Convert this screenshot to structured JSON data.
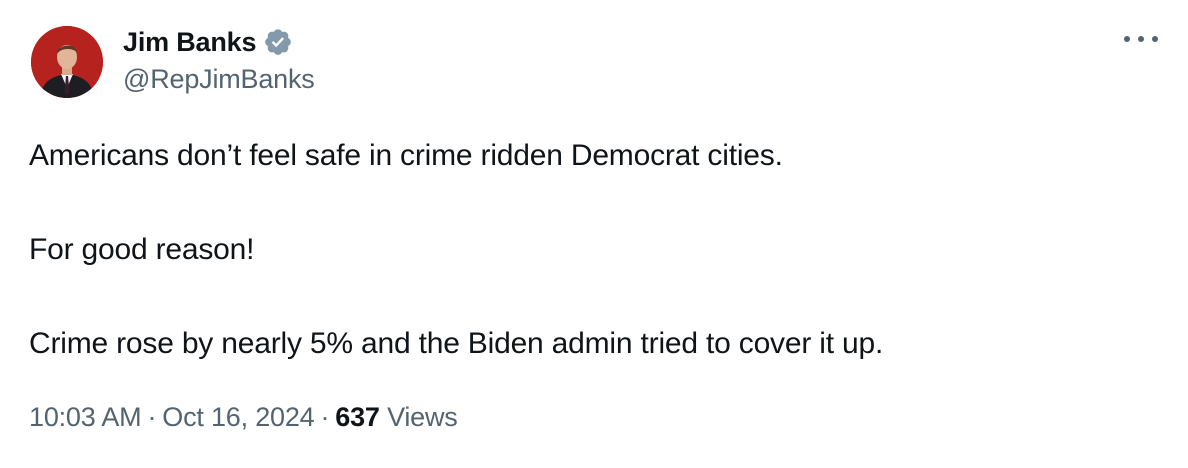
{
  "author": {
    "display_name": "Jim Banks",
    "handle": "@RepJimBanks",
    "verified_icon": "verified-badge-icon",
    "avatar_bg": "#b6231f"
  },
  "menu": {
    "icon": "more-options-icon"
  },
  "tweet": {
    "paragraphs": [
      "Americans don’t feel safe in crime ridden Democrat cities.",
      "For good reason!",
      "Crime rose by nearly 5% and the Biden admin tried to cover it up."
    ]
  },
  "meta": {
    "time": "10:03 AM",
    "separator": "·",
    "date": "Oct 16, 2024",
    "views_count": "637",
    "views_label": "Views"
  },
  "colors": {
    "text": "#0f1419",
    "secondary": "#536471",
    "verified": "#829aab"
  }
}
